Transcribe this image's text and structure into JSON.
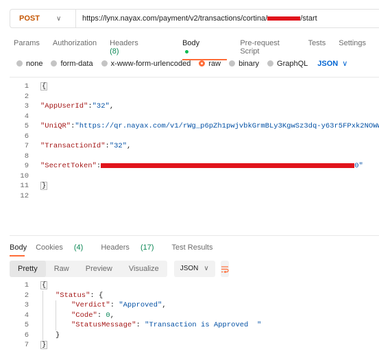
{
  "request": {
    "method": "POST",
    "url_prefix": "https://lynx.nayax.com/payment/v2/transactions/cortina/",
    "url_suffix": "/start"
  },
  "request_tabs": [
    {
      "label": "Params"
    },
    {
      "label": "Authorization"
    },
    {
      "label": "Headers",
      "count": "(8)"
    },
    {
      "label": "Body",
      "active": true
    },
    {
      "label": "Pre-request Script"
    },
    {
      "label": "Tests"
    },
    {
      "label": "Settings"
    }
  ],
  "body_types": {
    "none": "none",
    "form_data": "form-data",
    "urlencoded": "x-www-form-urlencoded",
    "raw": "raw",
    "binary": "binary",
    "graphql": "GraphQL",
    "selected": "raw",
    "language": "JSON"
  },
  "request_body": {
    "line_numbers": [
      "1",
      "2",
      "3",
      "4",
      "5",
      "6",
      "7",
      "8",
      "9",
      "10",
      "11",
      "12"
    ],
    "open_brace": "{",
    "close_brace": "}",
    "app_user_key": "\"AppUserId\"",
    "app_user_value": "\"32\"",
    "uniqr_key": "\"UniQR\"",
    "uniqr_value": "\"https://qr.nayax.com/v1/rWg_p6pZh1pwjvbkGrmBLy3KgwSz3dq-y63r5FPxk2NOWw2\"",
    "transaction_key": "\"TransactionId\"",
    "transaction_value": "\"32\"",
    "secret_key": "\"SecretToken\"",
    "secret_tail": "0\""
  },
  "response_tabs": [
    {
      "label": "Body",
      "active": true
    },
    {
      "label": "Cookies",
      "count": "(4)"
    },
    {
      "label": "Headers",
      "count": "(17)"
    },
    {
      "label": "Test Results"
    }
  ],
  "view_modes": {
    "pretty": "Pretty",
    "raw": "Raw",
    "preview": "Preview",
    "visualize": "Visualize",
    "format": "JSON"
  },
  "response_body": {
    "line_numbers": [
      "1",
      "2",
      "3",
      "4",
      "5",
      "6",
      "7"
    ],
    "open_brace": "{",
    "close_brace": "}",
    "status_key": "\"Status\"",
    "verdict_key": "\"Verdict\"",
    "verdict_value": "\"Approved\"",
    "code_key": "\"Code\"",
    "code_value": "0",
    "message_key": "\"StatusMessage\"",
    "message_value": "\"Transaction is Approved  \""
  },
  "colors": {
    "accent": "#ff6c37",
    "redaction": "#e1141c",
    "json_key": "#a31515",
    "json_string": "#0451a5"
  }
}
